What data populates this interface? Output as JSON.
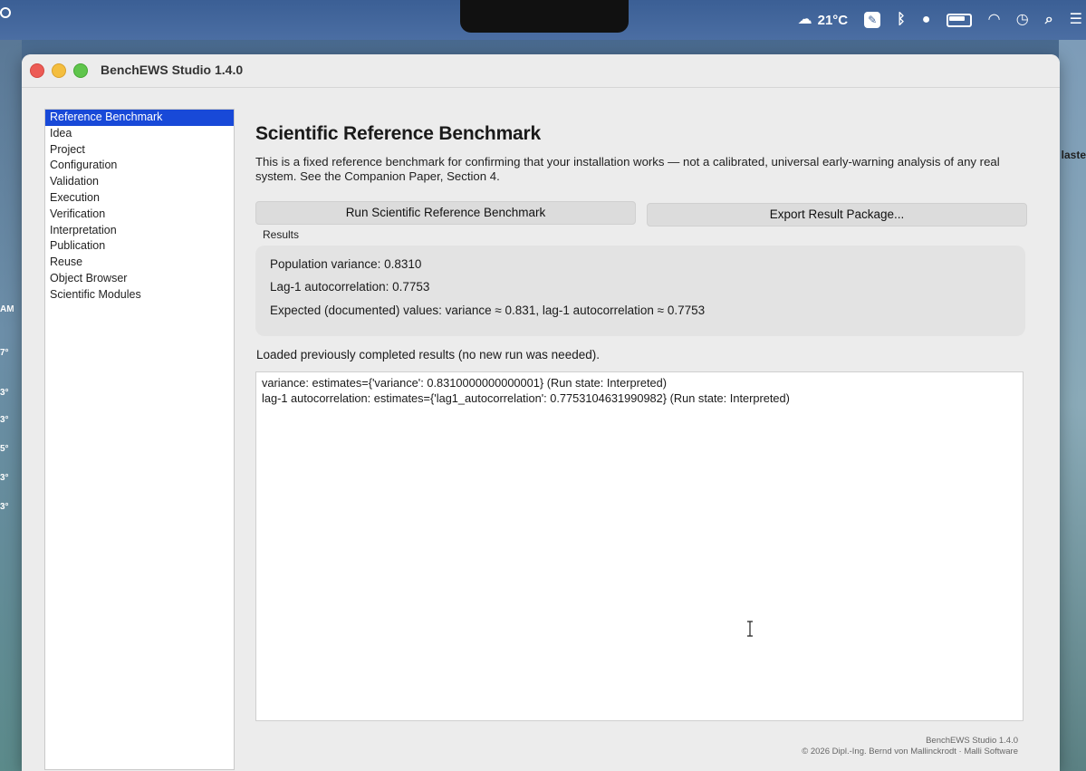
{
  "menubar": {
    "temperature": "21°C",
    "icons": [
      "weather-icon",
      "pen-icon",
      "bluetooth-icon",
      "user-icon",
      "battery-icon",
      "wifi-icon",
      "time-machine-icon",
      "search-icon",
      "control-center-icon"
    ]
  },
  "desktop": {
    "left_labels": [
      "AM",
      "7°",
      "3°",
      "3°",
      "5°",
      "3°",
      "3°"
    ],
    "right_label": "laste"
  },
  "window": {
    "title": "BenchEWS Studio 1.4.0"
  },
  "sidebar": {
    "items": [
      {
        "label": "Reference Benchmark",
        "active": true
      },
      {
        "label": "Idea"
      },
      {
        "label": "Project"
      },
      {
        "label": "Configuration"
      },
      {
        "label": "Validation"
      },
      {
        "label": "Execution"
      },
      {
        "label": "Verification"
      },
      {
        "label": "Interpretation"
      },
      {
        "label": "Publication"
      },
      {
        "label": "Reuse"
      },
      {
        "label": "Object Browser"
      },
      {
        "label": "Scientific Modules"
      }
    ]
  },
  "main": {
    "title": "Scientific Reference Benchmark",
    "description": "This is a fixed reference benchmark for confirming that your installation works — not a calibrated, universal early-warning analysis of any real system. See the Companion Paper, Section 4.",
    "run_button": "Run Scientific Reference Benchmark",
    "export_button": "Export Result Package...",
    "results_label": "Results",
    "results": {
      "variance": "Population variance: 0.8310",
      "autocorrelation": "Lag-1 autocorrelation: 0.7753",
      "expected": "Expected (documented) values: variance ≈ 0.831, lag-1 autocorrelation ≈ 0.7753"
    },
    "loaded_message": "Loaded previously completed results (no new run was needed).",
    "output_lines": [
      "variance: estimates={'variance': 0.8310000000000001} (Run state: Interpreted)",
      "lag-1 autocorrelation: estimates={'lag1_autocorrelation': 0.7753104631990982} (Run state: Interpreted)"
    ]
  },
  "footer": {
    "line1": "BenchEWS Studio 1.4.0",
    "line2": "© 2026 Dipl.-Ing. Bernd von Mallinckrodt · Malli Software"
  },
  "colors": {
    "accent": "#1849d8",
    "window_bg": "#ececec",
    "results_bg": "#e3e3e3"
  }
}
